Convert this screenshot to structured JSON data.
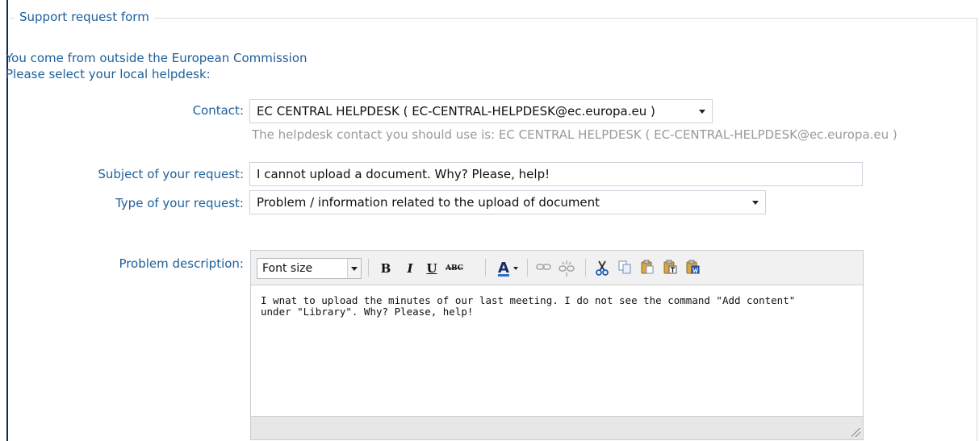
{
  "form": {
    "legend": "Support request form",
    "intro_line1": "You come from outside the European Commission",
    "intro_line2": "Please select your local helpdesk:"
  },
  "contact": {
    "label": "Contact:",
    "value": "EC CENTRAL HELPDESK ( EC-CENTRAL-HELPDESK@ec.europa.eu )",
    "hint": "The helpdesk contact you should use is: EC CENTRAL HELPDESK ( EC-CENTRAL-HELPDESK@ec.europa.eu )"
  },
  "subject": {
    "label": "Subject of your request:",
    "value": "I cannot upload a document. Why? Please, help!"
  },
  "type": {
    "label": "Type of your request:",
    "value": "Problem / information related to the upload of document"
  },
  "description": {
    "label": "Problem description:",
    "font_size_placeholder": "Font size",
    "toolbar": {
      "bold": "B",
      "italic": "I",
      "underline": "U",
      "strike": "ABC",
      "font_color": "A"
    },
    "text": "I wnat to upload the minutes of our last meeting. I do not see the command \"Add content\"\nunder \"Library\". Why? Please, help!"
  }
}
